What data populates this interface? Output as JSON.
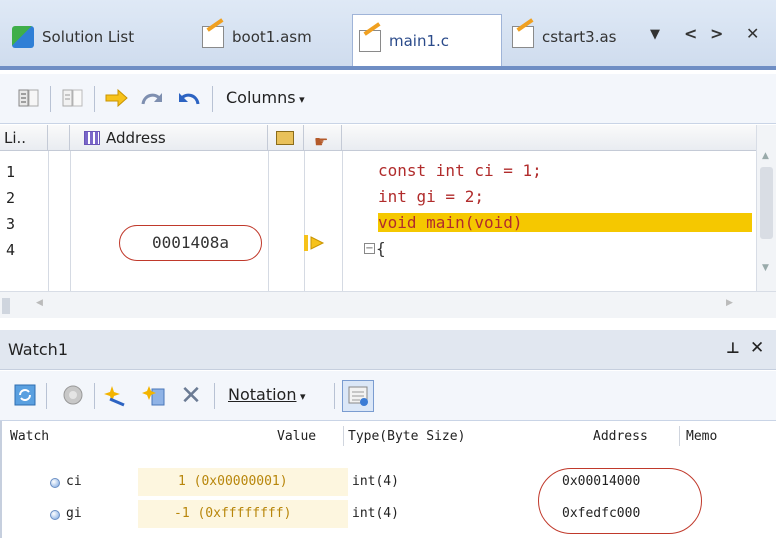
{
  "tabs": [
    {
      "label": "Solution List",
      "icon": "solution-icon",
      "active": false
    },
    {
      "label": "boot1.asm",
      "icon": "asm-file-icon",
      "active": false
    },
    {
      "label": "main1.c",
      "icon": "c-file-icon",
      "active": true
    },
    {
      "label": "cstart3.as",
      "icon": "asm-file-icon",
      "active": false
    }
  ],
  "tab_controls": {
    "dropdown": "▼",
    "prev": "<",
    "next": ">",
    "close": "✕"
  },
  "editor_toolbar": {
    "columns_label": "Columns"
  },
  "code_columns": {
    "line": "Li..",
    "address": "Address"
  },
  "code_lines": [
    {
      "num": "1",
      "text": "const int ci = 1;"
    },
    {
      "num": "2",
      "text": "int gi = 2;"
    },
    {
      "num": "3",
      "text": "void main(void)"
    },
    {
      "num": "4",
      "text": "{"
    }
  ],
  "current_address": "0001408a",
  "watch": {
    "title": "Watch1",
    "pin": "⊥",
    "close": "✕",
    "notation_label": "Notation",
    "columns": {
      "watch": "Watch",
      "value": "Value",
      "type": "Type(Byte Size)",
      "address": "Address",
      "memo": "Memo"
    },
    "rows": [
      {
        "name": "ci",
        "value": "1 (0x00000001)",
        "type": "int(4)",
        "address": "0x00014000"
      },
      {
        "name": "gi",
        "value": "-1 (0xffffffff)",
        "type": "int(4)",
        "address": "0xfedfc000"
      }
    ]
  },
  "colors": {
    "highlight": "#f5c800",
    "annotation": "#c0392b"
  }
}
